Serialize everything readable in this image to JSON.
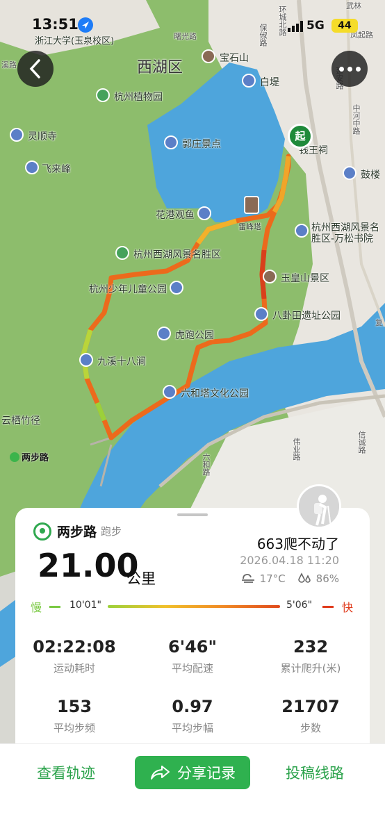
{
  "status": {
    "time": "13:51",
    "network": "5G",
    "battery": "44"
  },
  "map": {
    "district": "西湖区",
    "labels": {
      "zhejiang_univ": "浙江大学(玉泉校区)",
      "baoshishan": "宝石山",
      "baidi": "白堤",
      "botanical": "杭州植物园",
      "lingshun": "灵顺寺",
      "feilaifeng": "飞来峰",
      "guozhuang": "郭庄景点",
      "qianwangci": "钱王祠",
      "gulou": "鼓楼",
      "huagang": "花港观鱼",
      "leifeng": "雷峰塔",
      "wansong": "杭州西湖风景名胜区-万松书院",
      "scenic": "杭州西湖风景名胜区",
      "yuhuangshan": "玉皇山景区",
      "children_park": "杭州少年儿童公园",
      "bagua": "八卦田遗址公园",
      "hupao": "虎跑公园",
      "jiuxi": "九溪十八涧",
      "liuhe": "六和塔文化公园",
      "yunqi": "云栖竹径",
      "xiaohe": "溪路",
      "fengqi": "凤起路",
      "wulin": "武林",
      "yanan": "延安路",
      "zhongshan": "中河中路",
      "huanhe": "环城北路",
      "baochu": "保俶路",
      "shugang": "曙光路",
      "weiye": "伟业路",
      "xinyuan": "信诚路",
      "liuhe_road": "六和路",
      "fu": "复"
    },
    "start_marker": "起",
    "logo_text": "两步路"
  },
  "card": {
    "brand": "两步路",
    "sport": "跑步",
    "distance": "21.00",
    "distance_unit": "公里",
    "username": "663爬不动了",
    "datetime": "2026.04.18 11:20",
    "temperature": "17°C",
    "humidity": "86%",
    "pace_legend": {
      "slow_label": "慢",
      "slow_pace": "10'01\"",
      "fast_pace": "5'06\"",
      "fast_label": "快"
    },
    "stats": [
      {
        "value": "02:22:08",
        "label": "运动耗时"
      },
      {
        "value": "6'46\"",
        "label": "平均配速"
      },
      {
        "value": "232",
        "label": "累计爬升(米)"
      },
      {
        "value": "153",
        "label": "平均步频"
      },
      {
        "value": "0.97",
        "label": "平均步幅"
      },
      {
        "value": "21707",
        "label": "步数"
      }
    ]
  },
  "actions": {
    "view_track": "查看轨迹",
    "share": "分享记录",
    "submit_route": "投稿线路"
  },
  "colors": {
    "accent": "#2fb14f",
    "slow": "#7ac943",
    "fast": "#e03b1c",
    "lake": "#4aa3db",
    "terrain": "#8fbf6e"
  }
}
